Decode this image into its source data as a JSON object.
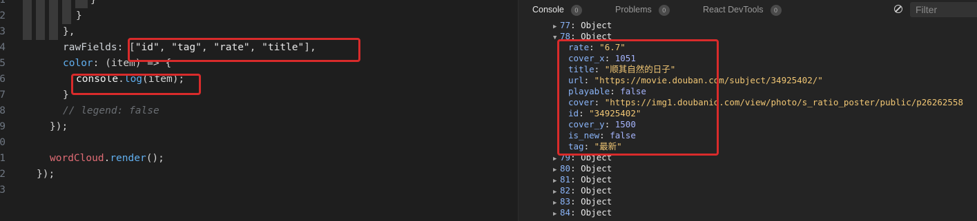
{
  "editor": {
    "lines": [
      {
        "num": "1",
        "tokens": [
          {
            "t": "}",
            "c": "punc"
          }
        ]
      },
      {
        "num": "2",
        "tokens": [
          {
            "t": "}",
            "c": "punc"
          }
        ]
      },
      {
        "num": "3",
        "tokens": [
          {
            "t": "},",
            "c": "punc"
          }
        ]
      },
      {
        "num": "4",
        "tokens": [
          {
            "t": "rawFields: ",
            "c": "prop"
          },
          {
            "t": "[",
            "c": "punc"
          },
          {
            "t": "\"id\"",
            "c": "str"
          },
          {
            "t": ", ",
            "c": "punc"
          },
          {
            "t": "\"tag\"",
            "c": "str"
          },
          {
            "t": ", ",
            "c": "punc"
          },
          {
            "t": "\"rate\"",
            "c": "str"
          },
          {
            "t": ", ",
            "c": "punc"
          },
          {
            "t": "\"title\"",
            "c": "str"
          },
          {
            "t": "],",
            "c": "punc"
          }
        ]
      },
      {
        "num": "5",
        "tokens": [
          {
            "t": "color",
            "c": "method"
          },
          {
            "t": ": ",
            "c": "punc"
          },
          {
            "t": "(item)",
            "c": "param"
          },
          {
            "t": " => {",
            "c": "punc"
          }
        ]
      },
      {
        "num": "6",
        "tokens": [
          {
            "t": "console",
            "c": "console"
          },
          {
            "t": ".",
            "c": "punc"
          },
          {
            "t": "log",
            "c": "method"
          },
          {
            "t": "(item);",
            "c": "punc"
          }
        ]
      },
      {
        "num": "7",
        "tokens": [
          {
            "t": "}",
            "c": "punc"
          }
        ]
      },
      {
        "num": "8",
        "tokens": [
          {
            "t": "// legend: false",
            "c": "comment"
          }
        ]
      },
      {
        "num": "9",
        "tokens": [
          {
            "t": "});",
            "c": "punc"
          }
        ]
      },
      {
        "num": "0",
        "tokens": []
      },
      {
        "num": "1",
        "tokens": [
          {
            "t": "wordCloud",
            "c": "key-red"
          },
          {
            "t": ".",
            "c": "punc"
          },
          {
            "t": "render",
            "c": "method"
          },
          {
            "t": "();",
            "c": "punc"
          }
        ]
      },
      {
        "num": "2",
        "tokens": [
          {
            "t": "});",
            "c": "punc"
          }
        ]
      },
      {
        "num": "3",
        "tokens": []
      }
    ]
  },
  "console": {
    "tabs": [
      {
        "label": "Console",
        "count": "0",
        "active": true
      },
      {
        "label": "Problems",
        "count": "0",
        "active": false
      },
      {
        "label": "React DevTools",
        "count": "0",
        "active": false
      }
    ],
    "filter_placeholder": "Filter",
    "items_before": [
      {
        "index": "77",
        "label": "Object",
        "expanded": false
      },
      {
        "index": "78",
        "label": "Object",
        "expanded": true
      }
    ],
    "expanded_fields": [
      {
        "key": "rate",
        "value": "\"6.7\"",
        "type": "str"
      },
      {
        "key": "cover_x",
        "value": "1051",
        "type": "num"
      },
      {
        "key": "title",
        "value": "\"顺其自然的日子\"",
        "type": "str"
      },
      {
        "key": "url",
        "value": "\"https://movie.douban.com/subject/34925402/\"",
        "type": "str"
      },
      {
        "key": "playable",
        "value": "false",
        "type": "bool"
      },
      {
        "key": "cover",
        "value": "\"https://img1.doubanio.com/view/photo/s_ratio_poster/public/p26262558",
        "type": "str"
      },
      {
        "key": "id",
        "value": "\"34925402\"",
        "type": "str"
      },
      {
        "key": "cover_y",
        "value": "1500",
        "type": "num"
      },
      {
        "key": "is_new",
        "value": "false",
        "type": "bool"
      },
      {
        "key": "tag",
        "value": "\"最新\"",
        "type": "str"
      }
    ],
    "items_after": [
      {
        "index": "79",
        "label": "Object",
        "expanded": false
      },
      {
        "index": "80",
        "label": "Object",
        "expanded": false
      },
      {
        "index": "81",
        "label": "Object",
        "expanded": false
      },
      {
        "index": "82",
        "label": "Object",
        "expanded": false
      },
      {
        "index": "83",
        "label": "Object",
        "expanded": false
      },
      {
        "index": "84",
        "label": "Object",
        "expanded": false
      }
    ]
  },
  "colors": {
    "highlight_box": "#d92b2b",
    "console_key": "#8ab4f8",
    "console_string": "#f0c674"
  }
}
